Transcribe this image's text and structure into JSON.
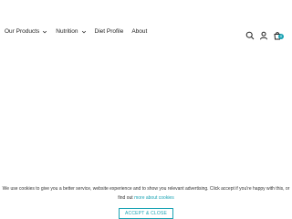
{
  "nav": {
    "items": [
      {
        "label": "Our Products",
        "has_dropdown": true
      },
      {
        "label": "Nutrition",
        "has_dropdown": true
      },
      {
        "label": "Diet Profile",
        "has_dropdown": false
      },
      {
        "label": "About",
        "has_dropdown": false
      }
    ],
    "icons": [
      "search-icon",
      "user-icon",
      "cart-icon"
    ],
    "cart_count": "0",
    "accent_color": "#1aa3b4"
  },
  "cookie": {
    "text": "We use cookies to give you a better service, website experience and to show you relevant advertising. Click accept if you're happy with this, or find out",
    "link_label": "more about cookies",
    "button_label": "ACCEPT & CLOSE"
  }
}
